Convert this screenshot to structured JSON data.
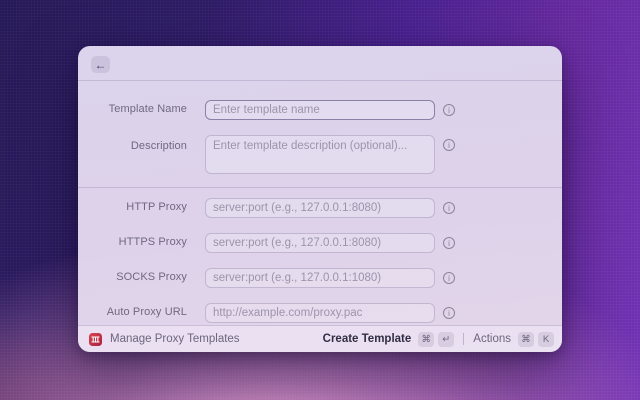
{
  "colors": {
    "desktop_top_left": "#251956",
    "desktop_top_right": "#7233b5",
    "desktop_bottom_pink": "#e7a0cd",
    "window_background": "#ddd3eb",
    "app_icon_red": "#c23347",
    "focused_border": "#504273"
  },
  "window": {
    "header": {
      "back_icon": "←"
    },
    "form": {
      "info_icon_glyph": "i",
      "fields": [
        {
          "label": "Template Name",
          "placeholder": "Enter template name",
          "type": "input",
          "focused": true
        },
        {
          "label": "Description",
          "placeholder": "Enter template description (optional)...",
          "type": "textarea",
          "focused": false
        },
        {
          "label": "HTTP Proxy",
          "placeholder": "server:port (e.g., 127.0.0.1:8080)",
          "type": "input",
          "focused": false
        },
        {
          "label": "HTTPS Proxy",
          "placeholder": "server:port (e.g., 127.0.0.1:8080)",
          "type": "input",
          "focused": false
        },
        {
          "label": "SOCKS Proxy",
          "placeholder": "server:port (e.g., 127.0.0.1:1080)",
          "type": "input",
          "focused": false
        },
        {
          "label": "Auto Proxy URL",
          "placeholder": "http://example.com/proxy.pac",
          "type": "input",
          "focused": false
        }
      ]
    },
    "statusbar": {
      "app_title": "Manage Proxy Templates",
      "primary_action": {
        "label": "Create Template",
        "keys": [
          "⌘",
          "↵"
        ]
      },
      "secondary_action": {
        "label": "Actions",
        "keys": [
          "⌘",
          "K"
        ]
      }
    }
  }
}
